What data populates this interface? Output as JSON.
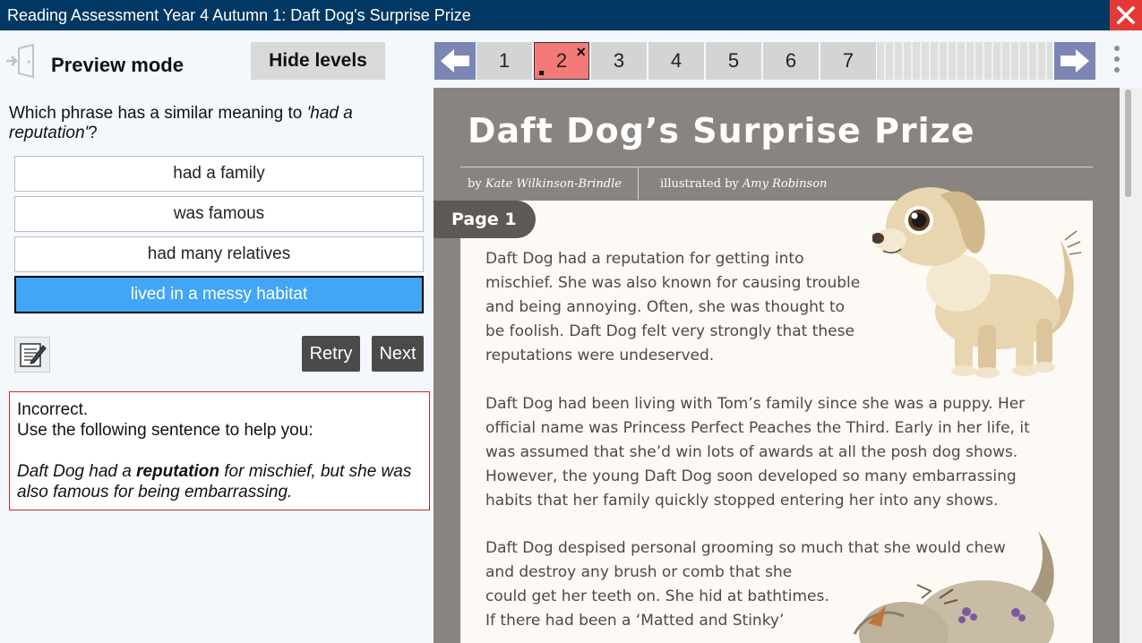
{
  "window": {
    "title": "Reading Assessment Year 4 Autumn 1: Daft Dog's Surprise Prize"
  },
  "left": {
    "preview_label": "Preview mode",
    "hide_levels_label": "Hide levels",
    "question_prefix": "Which phrase has a similar meaning to ",
    "question_quote": "'had a reputation'",
    "question_suffix": "?",
    "options": [
      {
        "label": "had a family",
        "selected": false
      },
      {
        "label": "was famous",
        "selected": false
      },
      {
        "label": "had many relatives",
        "selected": false
      },
      {
        "label": "lived in a messy habitat",
        "selected": true
      }
    ],
    "retry_label": "Retry",
    "next_label": "Next",
    "feedback": {
      "status": "Incorrect.",
      "instruction": "Use the following sentence to help you:",
      "hint_before": "Daft Dog had a ",
      "hint_bold": "reputation",
      "hint_after": " for mischief, but she was also famous for being embarrassing."
    }
  },
  "nav": {
    "pages": [
      "1",
      "2",
      "3",
      "4",
      "5",
      "6",
      "7"
    ],
    "current_page": "2",
    "current_mark": "×",
    "current_color": "#f47a7a"
  },
  "document": {
    "title": "Daft Dog’s Surprise Prize",
    "by_prefix": "by ",
    "author": "Kate Wilkinson-Brindle",
    "illus_prefix": "illustrated by ",
    "illustrator": "Amy Robinson",
    "page_label": "Page 1",
    "paragraph1": [
      "Daft Dog had a reputation for getting into",
      "mischief. She was also known for causing trouble",
      "and being annoying. Often, she was thought to",
      "be foolish. Daft Dog felt very strongly that these",
      "reputations were undeserved."
    ],
    "paragraph2": [
      "Daft Dog had been living with Tom’s family since she was a puppy. Her",
      "official name was Princess Perfect Peaches the Third. Early in her life, it",
      "was assumed that she’d win lots of awards at all the posh dog shows.",
      "However, the young Daft Dog soon developed so many embarrassing",
      "habits that her family quickly stopped entering her into any shows."
    ],
    "paragraph3": [
      "Daft Dog despised personal grooming so much that she would chew",
      "and destroy any brush or comb that she",
      "could get her teeth on. She hid at bathtimes.",
      "If there had been a ‘Matted and Stinky’"
    ]
  },
  "icons": {
    "close": "close-icon",
    "exit": "exit-door-icon",
    "notepad": "notepad-icon",
    "prev": "arrow-left-icon",
    "next": "arrow-right-icon",
    "menu": "kebab-menu-icon"
  }
}
